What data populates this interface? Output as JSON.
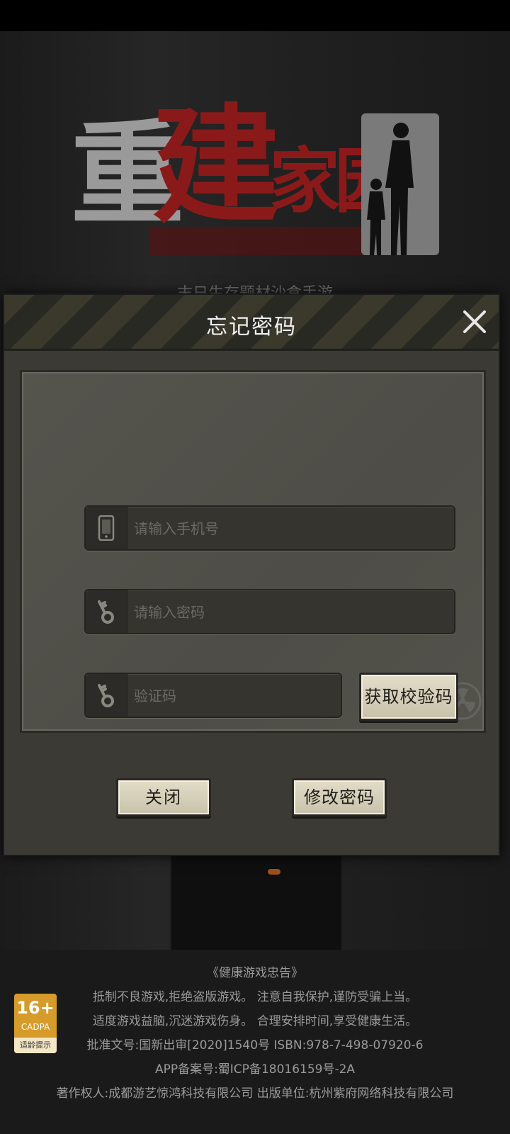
{
  "logo": {
    "chars": [
      "重",
      "建",
      "家园"
    ]
  },
  "background": {
    "subtitle_partial": "末日生存题材沙盒手游"
  },
  "dialog": {
    "title": "忘记密码",
    "phone_placeholder": "请输入手机号",
    "password_placeholder": "请输入密码",
    "code_placeholder": "验证码",
    "get_code_label": "获取校验码",
    "close_label": "关闭",
    "change_password_label": "修改密码"
  },
  "age_rating": {
    "age": "16+",
    "org": "CADPA",
    "tip": "适龄提示"
  },
  "footer": {
    "advisory_title": "《健康游戏忠告》",
    "advisory_line1": "抵制不良游戏,拒绝盗版游戏。 注意自我保护,谨防受骗上当。",
    "advisory_line2": "适度游戏益脑,沉迷游戏伤身。 合理安排时间,享受健康生活。",
    "approval": "批准文号:国新出审[2020]1540号     ISBN:978-7-498-07920-6",
    "icp": "APP备案号:蜀ICP备18016159号-2A",
    "copyright": "著作权人:成都游艺惊鸿科技有限公司 出版单位:杭州紫府网络科技有限公司"
  },
  "colors": {
    "accent_red": "#8a1a1a",
    "button_face": "#e3ddc9",
    "panel": "#55544d"
  }
}
